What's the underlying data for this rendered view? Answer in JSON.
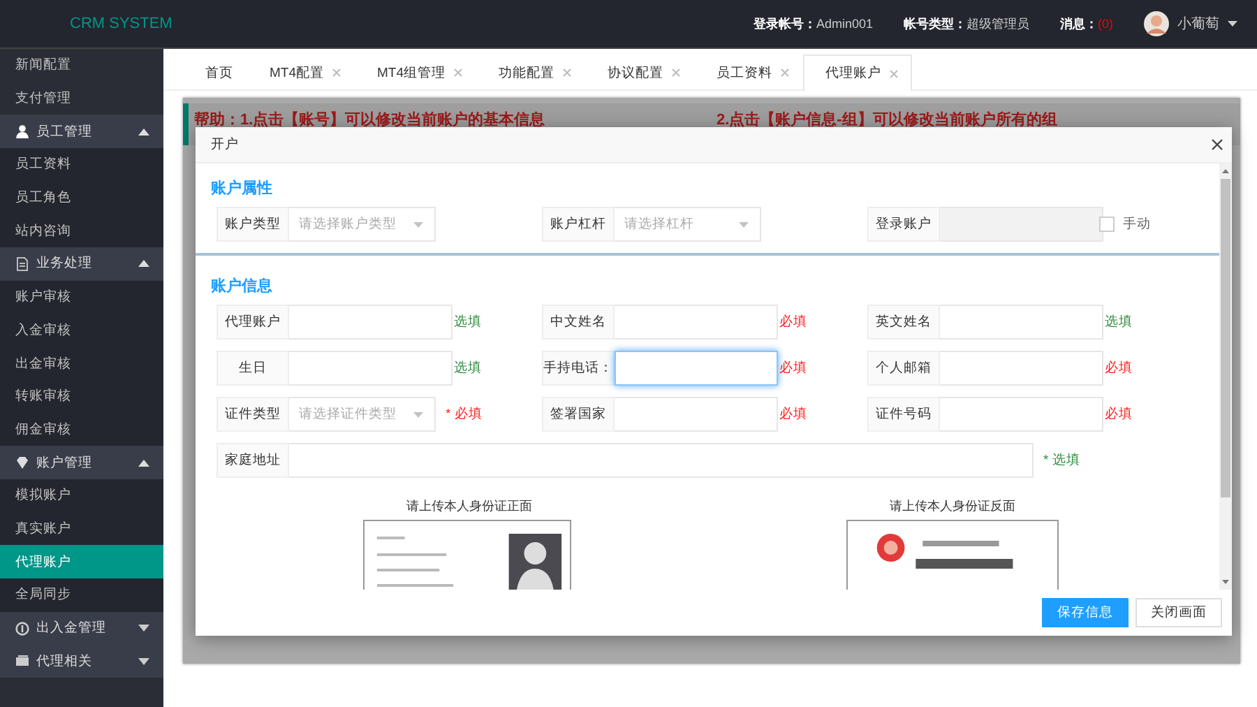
{
  "header": {
    "logo": "CRM SYSTEM",
    "login_label": "登录帐号：",
    "login": "Admin001",
    "type_label": "帐号类型：",
    "type": "超级管理员",
    "messages_label": "消息：",
    "messages": "(0)",
    "user": "小葡萄"
  },
  "sidebar": {
    "items": [
      {
        "label": "新闻配置",
        "kind": "item",
        "selected": false
      },
      {
        "label": "支付管理",
        "kind": "item",
        "selected": false
      },
      {
        "label": "员工管理",
        "kind": "group",
        "expanded": true,
        "children": [
          {
            "label": "员工资料",
            "selected": false
          },
          {
            "label": "员工角色",
            "selected": false
          },
          {
            "label": "站内咨询",
            "selected": false
          }
        ]
      },
      {
        "label": "业务处理",
        "kind": "group",
        "expanded": true,
        "children": [
          {
            "label": "账户审核",
            "selected": false
          },
          {
            "label": "入金审核",
            "selected": false
          },
          {
            "label": "出金审核",
            "selected": false
          },
          {
            "label": "转账审核",
            "selected": false
          },
          {
            "label": "佣金审核",
            "selected": false
          }
        ]
      },
      {
        "label": "账户管理",
        "kind": "group",
        "expanded": true,
        "children": [
          {
            "label": "模拟账户",
            "selected": false
          },
          {
            "label": "真实账户",
            "selected": false
          },
          {
            "label": "代理账户",
            "selected": true
          },
          {
            "label": "全局同步",
            "selected": false
          }
        ]
      },
      {
        "label": "出入金管理",
        "kind": "group",
        "expanded": false
      },
      {
        "label": "代理相关",
        "kind": "group",
        "expanded": false
      }
    ]
  },
  "tabs": [
    {
      "label": "首页",
      "closable": false,
      "selected": false
    },
    {
      "label": "MT4配置",
      "closable": true,
      "selected": false
    },
    {
      "label": "MT4组管理",
      "closable": true,
      "selected": false
    },
    {
      "label": "功能配置",
      "closable": true,
      "selected": false
    },
    {
      "label": "协议配置",
      "closable": true,
      "selected": false
    },
    {
      "label": "员工资料",
      "closable": true,
      "selected": false
    },
    {
      "label": "代理账户",
      "closable": true,
      "selected": true
    }
  ],
  "help": [
    "帮助：1.点击【账号】可以修改当前账户的基本信息",
    "2.点击【账户信息-组】可以修改当前账户所有的组"
  ],
  "modal": {
    "title": "开户",
    "sections": [
      {
        "title": "账户属性",
        "fields": [
          {
            "label": "账户类型",
            "kind": "select",
            "placeholder": "请选择账户类型"
          },
          {
            "label": "账户杠杆",
            "kind": "select",
            "placeholder": "请选择杠杆"
          },
          {
            "label": "登录账户",
            "kind": "input",
            "disabled": true
          },
          {
            "label": "手动",
            "kind": "checkbox",
            "checked": false
          }
        ]
      },
      {
        "title": "账户信息",
        "fields": [
          {
            "label": "代理账户",
            "kind": "input",
            "hint": "选填",
            "required": false
          },
          {
            "label": "中文姓名",
            "kind": "input",
            "hint": "必填",
            "required": true
          },
          {
            "label": "英文姓名",
            "kind": "input",
            "hint": "选填",
            "required": false
          },
          {
            "label": "生日",
            "kind": "input",
            "hint": "选填",
            "required": false
          },
          {
            "label": "手持电话：",
            "kind": "input",
            "hint": "必填",
            "required": true,
            "focused": true
          },
          {
            "label": "个人邮箱",
            "kind": "input",
            "hint": "必填",
            "required": true
          },
          {
            "label": "证件类型",
            "kind": "select",
            "placeholder": "请选择证件类型",
            "hint": "* 必填",
            "required": true
          },
          {
            "label": "签署国家",
            "kind": "input",
            "hint": "必填",
            "required": true
          },
          {
            "label": "证件号码",
            "kind": "input",
            "hint": "必填",
            "required": true
          },
          {
            "label": "家庭地址",
            "kind": "wide",
            "hint": "* 选填",
            "required": false
          }
        ]
      }
    ],
    "uploads": [
      {
        "caption": "请上传本人身份证正面",
        "kind": "front"
      },
      {
        "caption": "请上传本人身份证反面",
        "kind": "back"
      }
    ],
    "buttons": [
      {
        "label": "保存信息",
        "kind": "primary"
      },
      {
        "label": "关闭画面",
        "kind": "default"
      }
    ]
  }
}
